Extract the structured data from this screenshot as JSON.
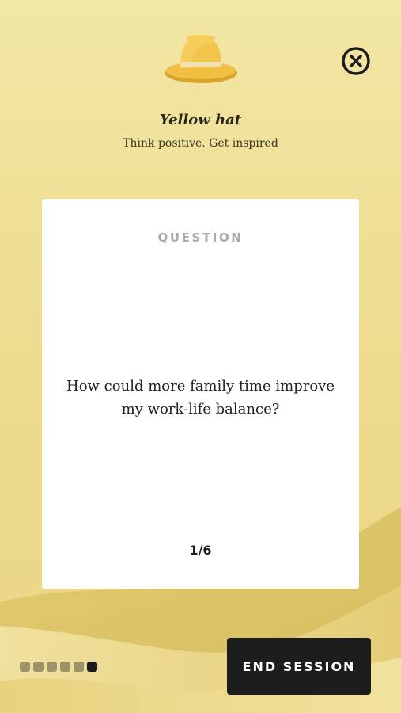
{
  "header": {
    "icon": "yellow-hat-icon",
    "title": "Yellow hat",
    "subtitle": "Think positive. Get inspired",
    "close_icon": "close-icon"
  },
  "card": {
    "label": "QUESTION",
    "question": "How could more family time improve my work-life balance?",
    "counter": "1/6"
  },
  "progress": {
    "total_steps": 6,
    "current_step": 6
  },
  "footer": {
    "end_label": "END SESSION"
  },
  "colors": {
    "background": "#efdf93",
    "card": "#ffffff",
    "button": "#1d1d1d",
    "hat": "#e8b53a"
  }
}
